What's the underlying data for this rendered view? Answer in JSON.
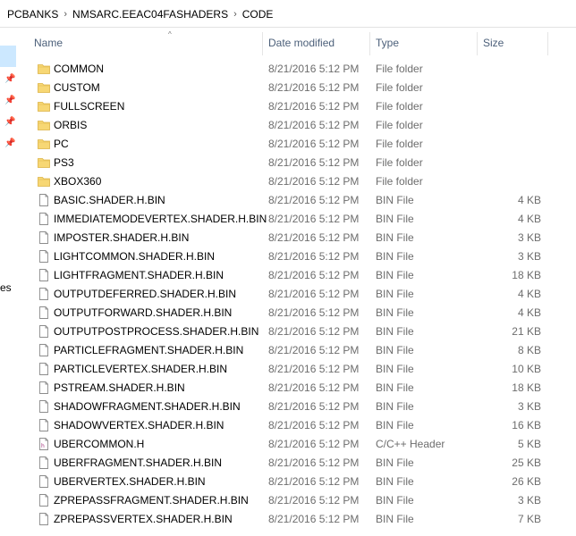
{
  "breadcrumb": [
    "PCBANKS",
    "NMSARC.EEAC04FASHADERS",
    "CODE"
  ],
  "sidebar_text": "es",
  "columns": {
    "name": "Name",
    "date": "Date modified",
    "type": "Type",
    "size": "Size"
  },
  "files": [
    {
      "name": "COMMON",
      "date": "8/21/2016 5:12 PM",
      "type": "File folder",
      "size": "",
      "icon": "folder-icon"
    },
    {
      "name": "CUSTOM",
      "date": "8/21/2016 5:12 PM",
      "type": "File folder",
      "size": "",
      "icon": "folder-icon"
    },
    {
      "name": "FULLSCREEN",
      "date": "8/21/2016 5:12 PM",
      "type": "File folder",
      "size": "",
      "icon": "folder-icon"
    },
    {
      "name": "ORBIS",
      "date": "8/21/2016 5:12 PM",
      "type": "File folder",
      "size": "",
      "icon": "folder-icon"
    },
    {
      "name": "PC",
      "date": "8/21/2016 5:12 PM",
      "type": "File folder",
      "size": "",
      "icon": "folder-icon"
    },
    {
      "name": "PS3",
      "date": "8/21/2016 5:12 PM",
      "type": "File folder",
      "size": "",
      "icon": "folder-icon"
    },
    {
      "name": "XBOX360",
      "date": "8/21/2016 5:12 PM",
      "type": "File folder",
      "size": "",
      "icon": "folder-icon"
    },
    {
      "name": "BASIC.SHADER.H.BIN",
      "date": "8/21/2016 5:12 PM",
      "type": "BIN File",
      "size": "4 KB",
      "icon": "file-icon"
    },
    {
      "name": "IMMEDIATEMODEVERTEX.SHADER.H.BIN",
      "date": "8/21/2016 5:12 PM",
      "type": "BIN File",
      "size": "4 KB",
      "icon": "file-icon"
    },
    {
      "name": "IMPOSTER.SHADER.H.BIN",
      "date": "8/21/2016 5:12 PM",
      "type": "BIN File",
      "size": "3 KB",
      "icon": "file-icon"
    },
    {
      "name": "LIGHTCOMMON.SHADER.H.BIN",
      "date": "8/21/2016 5:12 PM",
      "type": "BIN File",
      "size": "3 KB",
      "icon": "file-icon"
    },
    {
      "name": "LIGHTFRAGMENT.SHADER.H.BIN",
      "date": "8/21/2016 5:12 PM",
      "type": "BIN File",
      "size": "18 KB",
      "icon": "file-icon"
    },
    {
      "name": "OUTPUTDEFERRED.SHADER.H.BIN",
      "date": "8/21/2016 5:12 PM",
      "type": "BIN File",
      "size": "4 KB",
      "icon": "file-icon"
    },
    {
      "name": "OUTPUTFORWARD.SHADER.H.BIN",
      "date": "8/21/2016 5:12 PM",
      "type": "BIN File",
      "size": "4 KB",
      "icon": "file-icon"
    },
    {
      "name": "OUTPUTPOSTPROCESS.SHADER.H.BIN",
      "date": "8/21/2016 5:12 PM",
      "type": "BIN File",
      "size": "21 KB",
      "icon": "file-icon"
    },
    {
      "name": "PARTICLEFRAGMENT.SHADER.H.BIN",
      "date": "8/21/2016 5:12 PM",
      "type": "BIN File",
      "size": "8 KB",
      "icon": "file-icon"
    },
    {
      "name": "PARTICLEVERTEX.SHADER.H.BIN",
      "date": "8/21/2016 5:12 PM",
      "type": "BIN File",
      "size": "10 KB",
      "icon": "file-icon"
    },
    {
      "name": "PSTREAM.SHADER.H.BIN",
      "date": "8/21/2016 5:12 PM",
      "type": "BIN File",
      "size": "18 KB",
      "icon": "file-icon"
    },
    {
      "name": "SHADOWFRAGMENT.SHADER.H.BIN",
      "date": "8/21/2016 5:12 PM",
      "type": "BIN File",
      "size": "3 KB",
      "icon": "file-icon"
    },
    {
      "name": "SHADOWVERTEX.SHADER.H.BIN",
      "date": "8/21/2016 5:12 PM",
      "type": "BIN File",
      "size": "16 KB",
      "icon": "file-icon"
    },
    {
      "name": "UBERCOMMON.H",
      "date": "8/21/2016 5:12 PM",
      "type": "C/C++ Header",
      "size": "5 KB",
      "icon": "header-file-icon"
    },
    {
      "name": "UBERFRAGMENT.SHADER.H.BIN",
      "date": "8/21/2016 5:12 PM",
      "type": "BIN File",
      "size": "25 KB",
      "icon": "file-icon"
    },
    {
      "name": "UBERVERTEX.SHADER.H.BIN",
      "date": "8/21/2016 5:12 PM",
      "type": "BIN File",
      "size": "26 KB",
      "icon": "file-icon"
    },
    {
      "name": "ZPREPASSFRAGMENT.SHADER.H.BIN",
      "date": "8/21/2016 5:12 PM",
      "type": "BIN File",
      "size": "3 KB",
      "icon": "file-icon"
    },
    {
      "name": "ZPREPASSVERTEX.SHADER.H.BIN",
      "date": "8/21/2016 5:12 PM",
      "type": "BIN File",
      "size": "7 KB",
      "icon": "file-icon"
    }
  ],
  "colors": {
    "folder": "#f7d774",
    "header_text": "#4c607a",
    "secondary_text": "#6d6d6d",
    "selection": "#cce8ff"
  }
}
